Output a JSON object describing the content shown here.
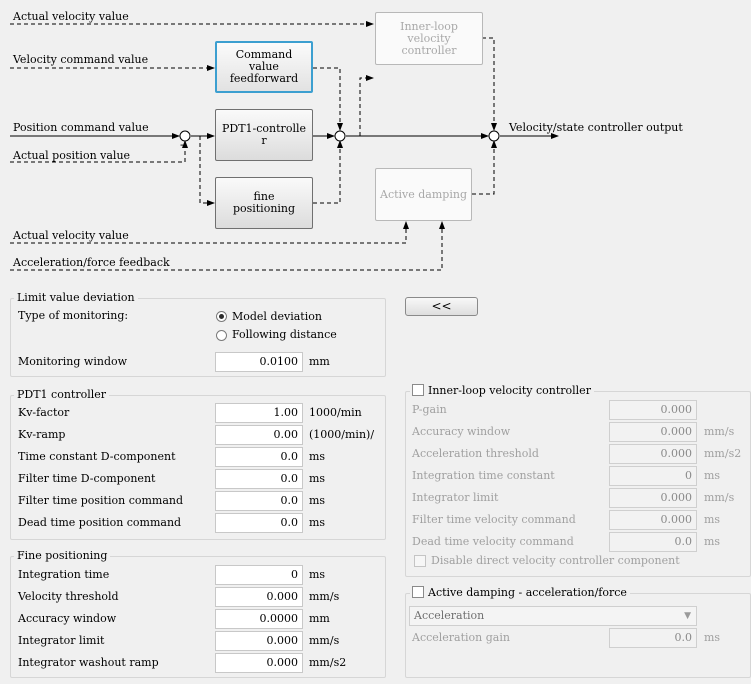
{
  "diagram": {
    "signals": {
      "actual_velocity_top": "Actual velocity value",
      "velocity_command": "Velocity command value",
      "position_command": "Position command value",
      "actual_position": "Actual position value",
      "actual_velocity_bottom": "Actual velocity value",
      "accel_feedback": "Acceleration/force feedback",
      "output": "Velocity/state controller output",
      "minus_sign": "-"
    },
    "blocks": {
      "feedforward": "Command value feedforward",
      "pdt1": "PDT1-controlle r",
      "fine": "fine positioning",
      "inner_loop": "Inner-loop velocity controller",
      "active_damping": "Active damping"
    }
  },
  "collapse_button": {
    "label": "<<"
  },
  "limit_group": {
    "title": "Limit value deviation",
    "monitoring_type_label": "Type of monitoring:",
    "radio_model": "Model deviation",
    "radio_following": "Following distance",
    "selected": "Model deviation",
    "window_label": "Monitoring window",
    "window_value": "0.0100",
    "window_unit": "mm"
  },
  "pdt1_group": {
    "title": "PDT1 controller",
    "rows": [
      {
        "label": "Kv-factor",
        "value": "1.00",
        "unit": "1000/min"
      },
      {
        "label": "Kv-ramp",
        "value": "0.00",
        "unit": "(1000/min)/"
      },
      {
        "label": "Time constant D-component",
        "value": "0.0",
        "unit": "ms"
      },
      {
        "label": "Filter time D-component",
        "value": "0.0",
        "unit": "ms"
      },
      {
        "label": "Filter time position command",
        "value": "0.0",
        "unit": "ms"
      },
      {
        "label": "Dead time position command",
        "value": "0.0",
        "unit": "ms"
      }
    ]
  },
  "fine_group": {
    "title": "Fine positioning",
    "rows": [
      {
        "label": "Integration time",
        "value": "0",
        "unit": "ms"
      },
      {
        "label": "Velocity threshold",
        "value": "0.000",
        "unit": "mm/s"
      },
      {
        "label": "Accuracy window",
        "value": "0.0000",
        "unit": "mm"
      },
      {
        "label": "Integrator limit",
        "value": "0.000",
        "unit": "mm/s"
      },
      {
        "label": "Integrator washout ramp",
        "value": "0.000",
        "unit": "mm/s2"
      }
    ]
  },
  "inner_group": {
    "title": "Inner-loop velocity controller",
    "rows": [
      {
        "label": "P-gain",
        "value": "0.000",
        "unit": ""
      },
      {
        "label": "Accuracy window",
        "value": "0.000",
        "unit": "mm/s"
      },
      {
        "label": "Acceleration threshold",
        "value": "0.000",
        "unit": "mm/s2"
      },
      {
        "label": "Integration time constant",
        "value": "0",
        "unit": "ms"
      },
      {
        "label": "Integrator limit",
        "value": "0.000",
        "unit": "mm/s"
      },
      {
        "label": "Filter time velocity command",
        "value": "0.000",
        "unit": "ms"
      },
      {
        "label": "Dead time velocity command",
        "value": "0.0",
        "unit": "ms"
      }
    ],
    "disable_checkbox": "Disable direct velocity controller component"
  },
  "damping_group": {
    "title": "Active damping - acceleration/force",
    "select_value": "Acceleration",
    "gain_label": "Acceleration gain",
    "gain_value": "0.0",
    "gain_unit": "ms"
  },
  "colors": {
    "accent_border": "#3c9fd0",
    "disabled_text": "#a0a0a0"
  }
}
